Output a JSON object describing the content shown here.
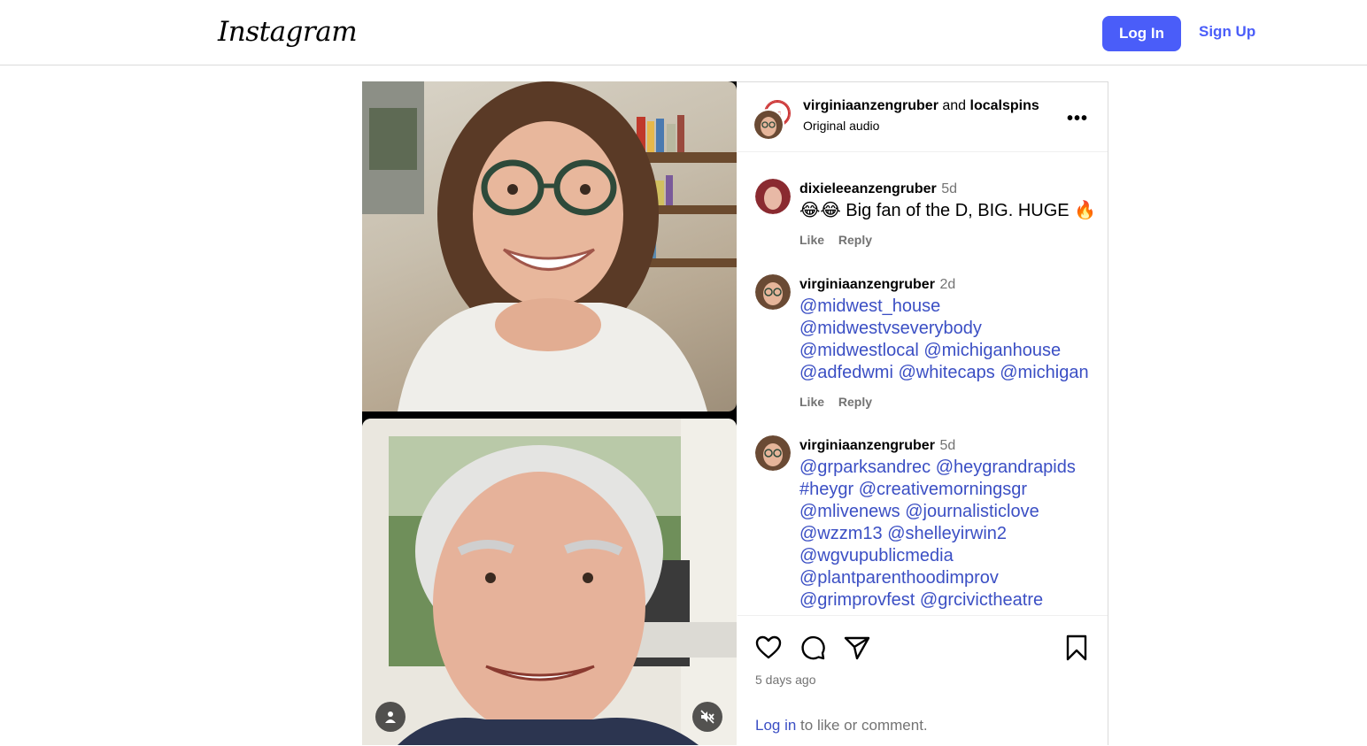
{
  "header": {
    "logo_text": "Instagram",
    "login_label": "Log In",
    "signup_label": "Sign Up"
  },
  "post": {
    "author1": "virginiaanzengruber",
    "joiner": "and",
    "author2": "localspins",
    "audio": "Original audio",
    "more": "•••",
    "time_ago": "5 days ago",
    "login_link": "Log in",
    "login_suffix": " to like or comment."
  },
  "comments": [
    {
      "user": "dixieleeanzengruber",
      "time": "5d",
      "text": "😂😂 Big fan of the D, BIG. HUGE 🔥",
      "like": "Like",
      "reply": "Reply"
    },
    {
      "user": "virginiaanzengruber",
      "time": "2d",
      "lines": [
        "@midwest_house",
        "@midwestvseverybody",
        "@midwestlocal @michiganhouse",
        "@adfedwmi @whitecaps @michigan"
      ],
      "like": "Like",
      "reply": "Reply"
    },
    {
      "user": "virginiaanzengruber",
      "time": "5d",
      "lines": [
        "@grparksandrec @heygrandrapids",
        "#heygr @creativemorningsgr",
        "@mlivenews @journalisticlove",
        "@wzzm13 @shelleyirwin2",
        "@wgvupublicmedia",
        "@plantparenthoodimprov",
        "@grimprovfest @grcivictheatre"
      ]
    }
  ],
  "icons": {
    "like": "heart-icon",
    "comment": "comment-icon",
    "share": "share-icon",
    "save": "bookmark-icon",
    "profile": "person-icon",
    "mute": "muted-speaker-icon"
  },
  "colors": {
    "accent": "#4a5df9",
    "mention": "#3b4fc4",
    "muted": "#737373"
  }
}
